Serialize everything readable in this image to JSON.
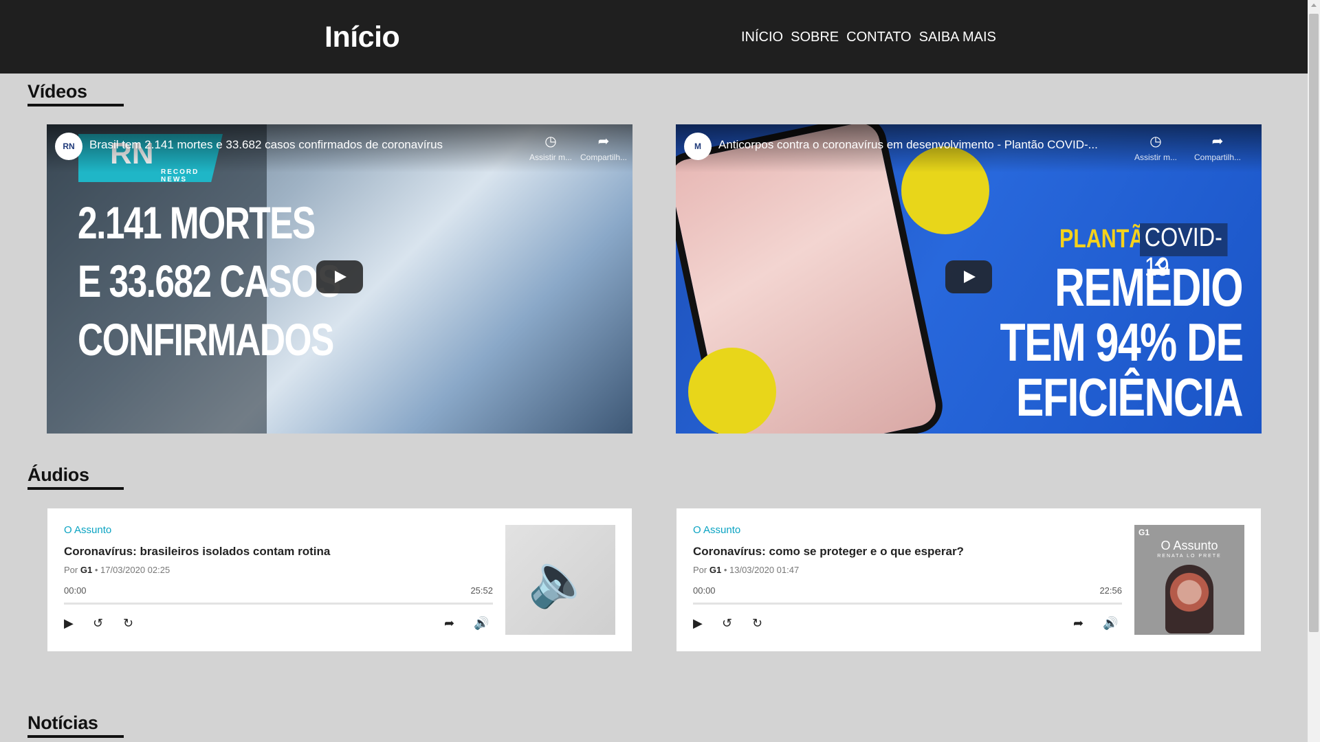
{
  "header": {
    "title": "Início",
    "nav": [
      "INÍCIO",
      "SOBRE",
      "CONTATO",
      "SAIBA MAIS"
    ]
  },
  "sections": {
    "videos": "Vídeos",
    "audios": "Áudios",
    "news": "Notícias"
  },
  "videos": [
    {
      "title": "Brasil tem 2.141 mortes e 33.682 casos confirmados de coronavírus",
      "channel_badge": "RN",
      "watch_later": "Assistir m...",
      "share": "Compartilh...",
      "logo_text": "RN",
      "logo_sub": "RECORD NEWS",
      "overlay_lines": [
        "2.141 MORTES",
        "E 33.682 CASOS",
        "CONFIRMADOS"
      ]
    },
    {
      "title": "Anticorpos contra o coronavírus em desenvolvimento - Plantão COVID-...",
      "channel_badge": "M",
      "watch_later": "Assistir m...",
      "share": "Compartilh...",
      "tag_1": "PLANTÃO",
      "tag_2": "COVID-19",
      "overlay_lines": [
        "REMÉDIO",
        "TEM 94% DE",
        "EFICIÊNCIA"
      ]
    }
  ],
  "audios": [
    {
      "channel": "O Assunto",
      "title": "Coronavírus: brasileiros isolados contam rotina",
      "by": "Por",
      "author": "G1",
      "date": "• 17/03/2020 02:25",
      "current": "00:00",
      "duration": "25:52",
      "progress": 0
    },
    {
      "channel": "O Assunto",
      "title": "Coronavírus: como se proteger e o que esperar?",
      "by": "Por",
      "author": "G1",
      "date": "• 13/03/2020 01:47",
      "current": "00:00",
      "duration": "22:56",
      "progress": 0,
      "cover_brand": "G1",
      "cover_title": "O Assunto",
      "cover_subtitle": "RENATA LO PRETE"
    }
  ],
  "colors": {
    "header_bg": "#1f1f1f",
    "page_bg": "#d3d3d3",
    "accent": "#0aa3c2"
  },
  "icons": {
    "play": "play-icon",
    "rewind": "rewind-15-icon",
    "forward": "forward-15-icon",
    "share": "share-icon",
    "volume": "volume-icon",
    "clock": "clock-icon",
    "speaker": "speaker-icon"
  }
}
